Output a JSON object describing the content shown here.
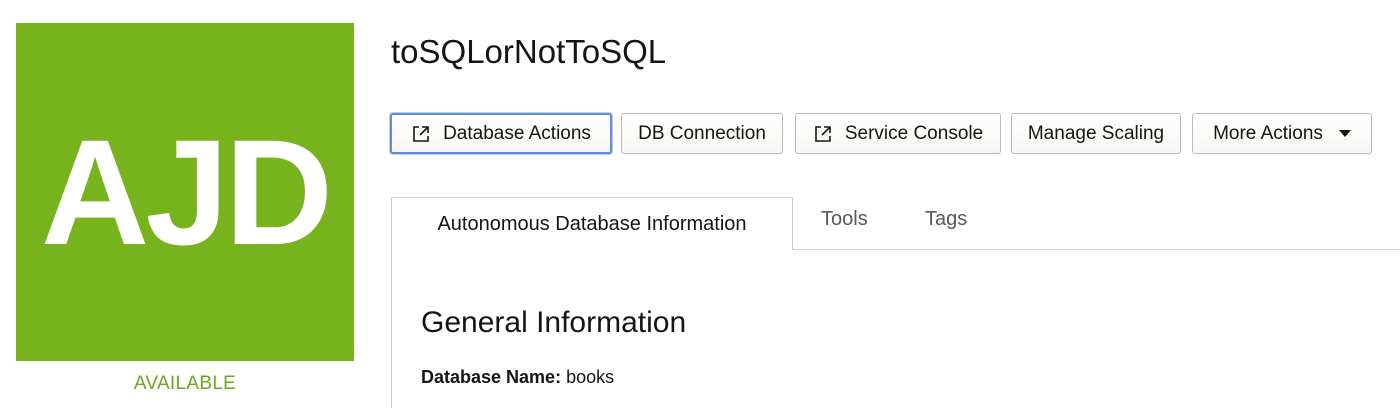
{
  "tile": {
    "abbreviation": "AJD",
    "status": "AVAILABLE",
    "tile_color": "#76b31c",
    "status_color": "#6fa61d"
  },
  "header": {
    "title": "toSQLorNotToSQL"
  },
  "actions": {
    "database_actions": "Database Actions",
    "db_connection": "DB Connection",
    "service_console": "Service Console",
    "manage_scaling": "Manage Scaling",
    "more_actions": "More Actions"
  },
  "icons": {
    "external_link": "external-link-icon",
    "dropdown": "caret-down-icon"
  },
  "tabs": [
    {
      "label": "Autonomous Database Information",
      "active": true
    },
    {
      "label": "Tools",
      "active": false
    },
    {
      "label": "Tags",
      "active": false
    }
  ],
  "general": {
    "heading": "General Information",
    "database_name_label": "Database Name:",
    "database_name_value": "books"
  }
}
